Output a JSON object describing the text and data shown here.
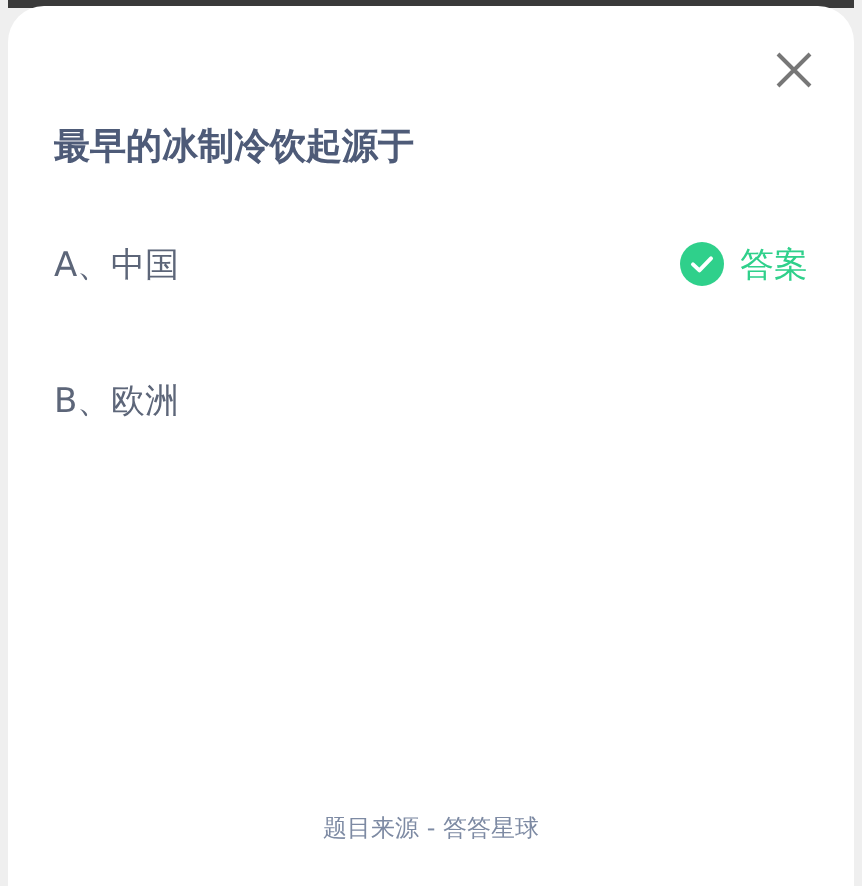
{
  "question": "最早的冰制冷饮起源于",
  "options": [
    {
      "label": "A、中国",
      "correct": true,
      "answer_label": "答案"
    },
    {
      "label": "B、欧洲",
      "correct": false
    }
  ],
  "footer": "题目来源 - 答答星球"
}
